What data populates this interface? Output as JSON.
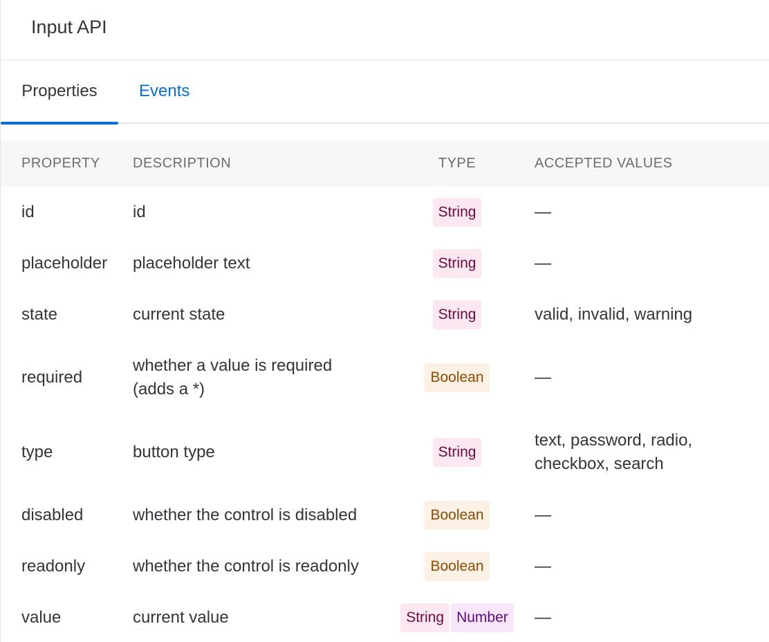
{
  "header": {
    "title": "Input API"
  },
  "tabs": [
    {
      "label": "Properties",
      "active": true
    },
    {
      "label": "Events",
      "active": false
    }
  ],
  "colors": {
    "accent": "#0a6ed1",
    "string_bg": "#fde7f1",
    "string_fg": "#6b0b3b",
    "boolean_bg": "#fdf0e4",
    "boolean_fg": "#8a4a00",
    "number_bg": "#f7e6fc",
    "number_fg": "#5a0d7a"
  },
  "table": {
    "headers": {
      "property": "PROPERTY",
      "description": "DESCRIPTION",
      "type": "TYPE",
      "accepted": "ACCEPTED VALUES"
    },
    "rows": [
      {
        "property": "id",
        "description_1": "id",
        "description_2": "",
        "types": [
          "String"
        ],
        "accepted_1": "—",
        "accepted_2": ""
      },
      {
        "property": "placeholder",
        "description_1": "placeholder text",
        "description_2": "",
        "types": [
          "String"
        ],
        "accepted_1": "—",
        "accepted_2": ""
      },
      {
        "property": "state",
        "description_1": "current state",
        "description_2": "",
        "types": [
          "String"
        ],
        "accepted_1": "valid, invalid, warning",
        "accepted_2": ""
      },
      {
        "property": "required",
        "description_1": "whether a value is required",
        "description_2": "(adds a *)",
        "types": [
          "Boolean"
        ],
        "accepted_1": "—",
        "accepted_2": ""
      },
      {
        "property": "type",
        "description_1": "button type",
        "description_2": "",
        "types": [
          "String"
        ],
        "accepted_1": "text, password, radio,",
        "accepted_2": "checkbox, search"
      },
      {
        "property": "disabled",
        "description_1": "whether the control is disabled",
        "description_2": "",
        "types": [
          "Boolean"
        ],
        "accepted_1": "—",
        "accepted_2": ""
      },
      {
        "property": "readonly",
        "description_1": "whether the control is readonly",
        "description_2": "",
        "types": [
          "Boolean"
        ],
        "accepted_1": "—",
        "accepted_2": ""
      },
      {
        "property": "value",
        "description_1": "current value",
        "description_2": "",
        "types": [
          "String",
          "Number"
        ],
        "accepted_1": "—",
        "accepted_2": ""
      }
    ]
  }
}
